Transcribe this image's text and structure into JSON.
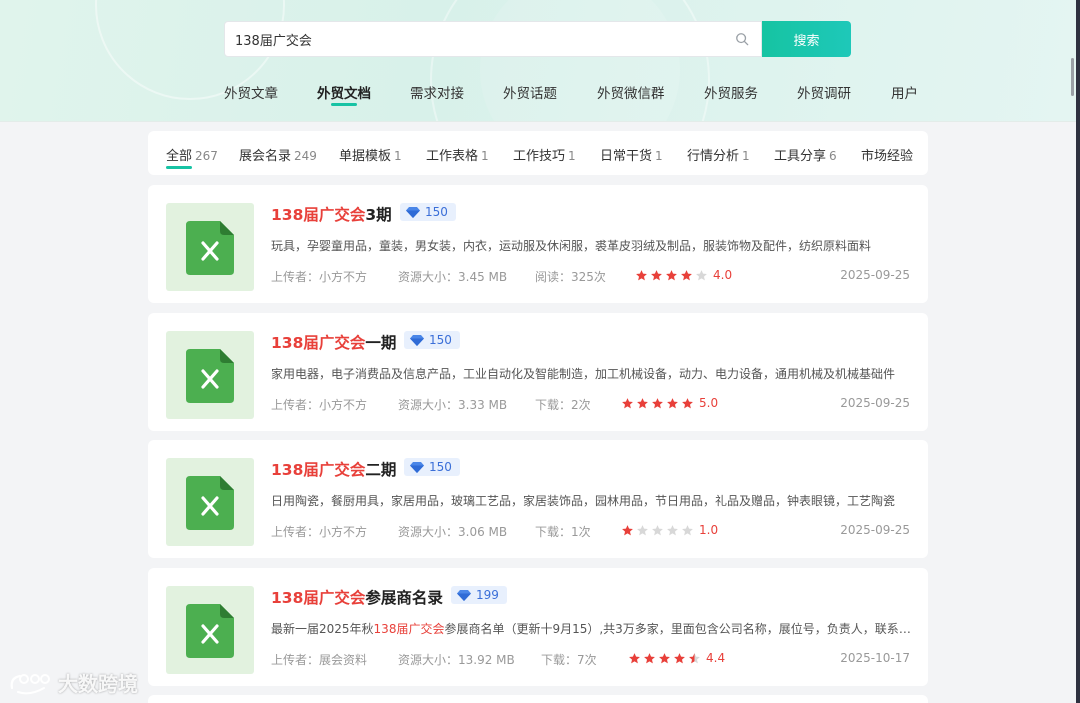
{
  "search": {
    "value": "138届广交会",
    "button_label": "搜索"
  },
  "main_nav": [
    {
      "label": "外贸文章"
    },
    {
      "label": "外贸文档"
    },
    {
      "label": "需求对接"
    },
    {
      "label": "外贸话题"
    },
    {
      "label": "外贸微信群"
    },
    {
      "label": "外贸服务"
    },
    {
      "label": "外贸调研"
    },
    {
      "label": "用户"
    }
  ],
  "active_nav": "外贸文档",
  "tabs": [
    {
      "label": "全部",
      "count": "267"
    },
    {
      "label": "展会名录",
      "count": "249"
    },
    {
      "label": "单据模板",
      "count": "1"
    },
    {
      "label": "工作表格",
      "count": "1"
    },
    {
      "label": "工作技巧",
      "count": "1"
    },
    {
      "label": "日常干货",
      "count": "1"
    },
    {
      "label": "行情分析",
      "count": "1"
    },
    {
      "label": "工具分享",
      "count": "6"
    },
    {
      "label": "市场经验",
      "count": ""
    }
  ],
  "colors": {
    "accent": "#17c3a4",
    "highlight": "#e8403a",
    "star_off": "#d8d8d8",
    "badge_bg": "#e8f0fd",
    "badge_text": "#3b6fd8"
  },
  "documents": [
    {
      "title_hl": "138届广交会",
      "title_rest": "3期",
      "price": "150",
      "desc_pre": "",
      "desc_hl": "",
      "desc": "玩具，孕婴童用品，童装，男女装，内衣，运动服及休闲服，裘革皮羽绒及制品，服装饰物及配件，纺织原料面料",
      "uploader": "上传者：小方不方",
      "size": "资源大小：3.45 MB",
      "stat": "阅读：325次",
      "rating": 4.0,
      "rating_label": "4.0",
      "date": "2025-09-25"
    },
    {
      "title_hl": "138届广交会",
      "title_rest": "一期",
      "price": "150",
      "desc_pre": "",
      "desc_hl": "",
      "desc": "家用电器，电子消费品及信息产品，工业自动化及智能制造，加工机械设备，动力、电力设备，通用机械及机械基础件",
      "uploader": "上传者：小方不方",
      "size": "资源大小：3.33 MB",
      "stat": "下载：2次",
      "rating": 5.0,
      "rating_label": "5.0",
      "date": "2025-09-25"
    },
    {
      "title_hl": "138届广交会",
      "title_rest": "二期",
      "price": "150",
      "desc_pre": "",
      "desc_hl": "",
      "desc": "日用陶瓷，餐厨用具，家居用品，玻璃工艺品，家居装饰品，园林用品，节日用品，礼品及赠品，钟表眼镜，工艺陶瓷",
      "uploader": "上传者：小方不方",
      "size": "资源大小：3.06 MB",
      "stat": "下载：1次",
      "rating": 1.0,
      "rating_label": "1.0",
      "date": "2025-09-25"
    },
    {
      "title_hl": "138届广交会",
      "title_rest": "参展商名录",
      "price": "199",
      "desc_pre": "最新一届2025年秋",
      "desc_hl": "138届广交会",
      "desc": "参展商名单（更新十9月15）,共3万多家，里面包含公司名称，展位号，负责人，联系电话",
      "uploader": "上传者：展会资料",
      "size": "资源大小：13.92 MB",
      "stat": "下载：7次",
      "rating": 4.4,
      "rating_label": "4.4",
      "date": "2025-10-17"
    }
  ],
  "watermark": "大数跨境"
}
